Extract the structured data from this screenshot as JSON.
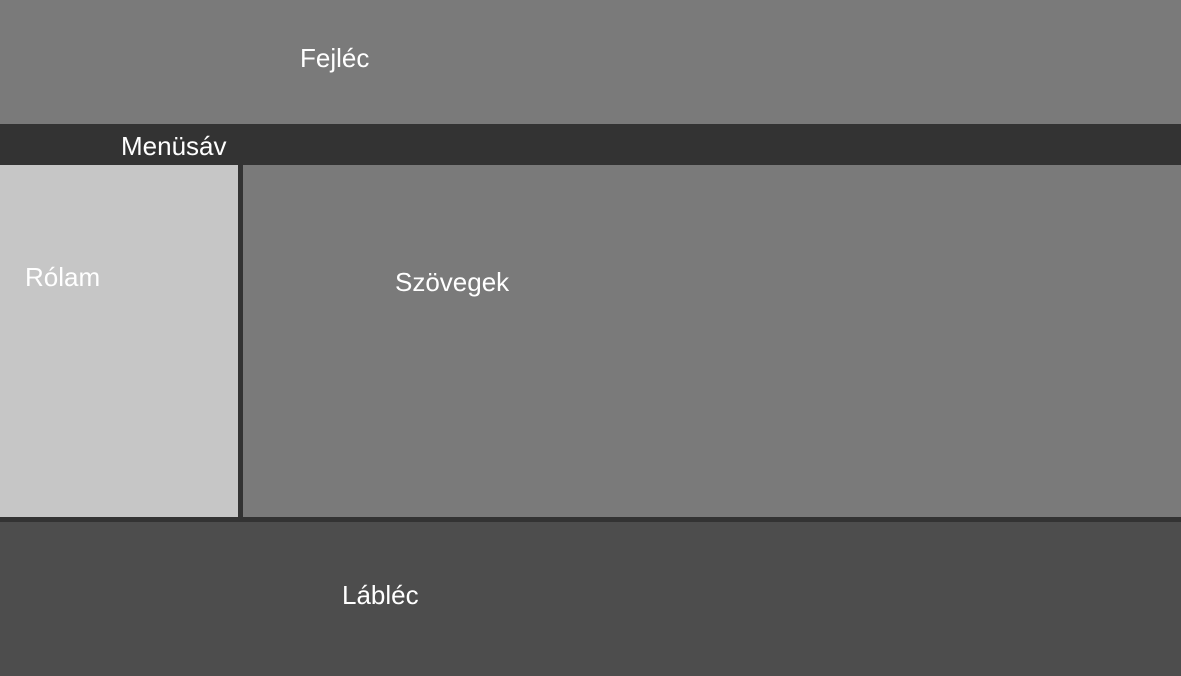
{
  "header": {
    "title": "Fejléc"
  },
  "menubar": {
    "label": "Menüsáv"
  },
  "sidebar": {
    "title": "Rólam"
  },
  "main": {
    "title": "Szövegek"
  },
  "footer": {
    "title": "Lábléc"
  },
  "colors": {
    "header_bg": "#7a7a7a",
    "menubar_bg": "#333333",
    "sidebar_bg": "#c6c6c6",
    "main_bg": "#7a7a7a",
    "footer_bg": "#4d4d4d",
    "text": "#ffffff"
  }
}
